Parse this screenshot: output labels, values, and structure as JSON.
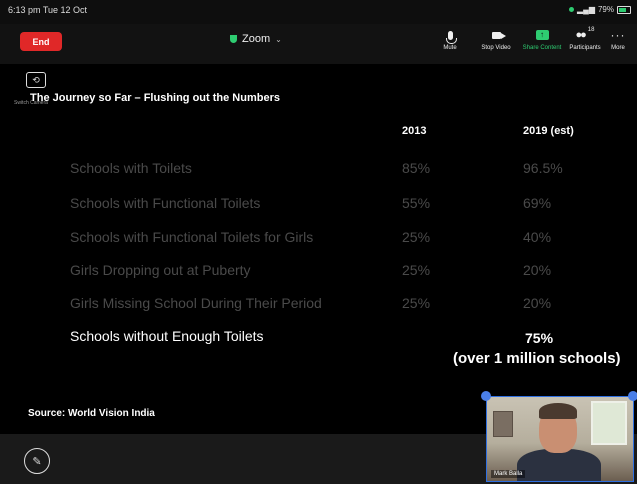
{
  "status_bar": {
    "time": "6:13 pm  Tue 12 Oct",
    "battery": "79%"
  },
  "toolbar": {
    "end_label": "End",
    "meeting_title": "Zoom",
    "mute_label": "Mute",
    "stop_video_label": "Stop Video",
    "share_label": "Share Content",
    "participants_label": "Participants",
    "participants_count": "18",
    "more_label": "More"
  },
  "switch_camera_label": "Switch Camera",
  "slide": {
    "title": "The Journey so Far – Flushing out the Numbers",
    "col_2013": "2013",
    "col_2019": "2019 (est)",
    "rows": [
      {
        "label": "Schools with Toilets",
        "v2013": "85%",
        "v2019": "96.5%"
      },
      {
        "label": "Schools with Functional Toilets",
        "v2013": "55%",
        "v2019": "69%"
      },
      {
        "label": "Schools with Functional Toilets for Girls",
        "v2013": "25%",
        "v2019": "40%"
      },
      {
        "label": "Girls Dropping out at Puberty",
        "v2013": "25%",
        "v2019": "20%"
      },
      {
        "label": "Girls Missing School During Their Period",
        "v2013": "25%",
        "v2019": "20%"
      },
      {
        "label": "Schools without Enough Toilets",
        "v2013": "",
        "v2019": "75%"
      }
    ],
    "note": "(over 1 million schools)",
    "source": "Source: World Vision India"
  },
  "video": {
    "name": "Mark Balla"
  },
  "colors": {
    "end": "#e02828",
    "share": "#2ecc71",
    "highlight": "#ffffff",
    "dim": "#4a4a4a"
  }
}
